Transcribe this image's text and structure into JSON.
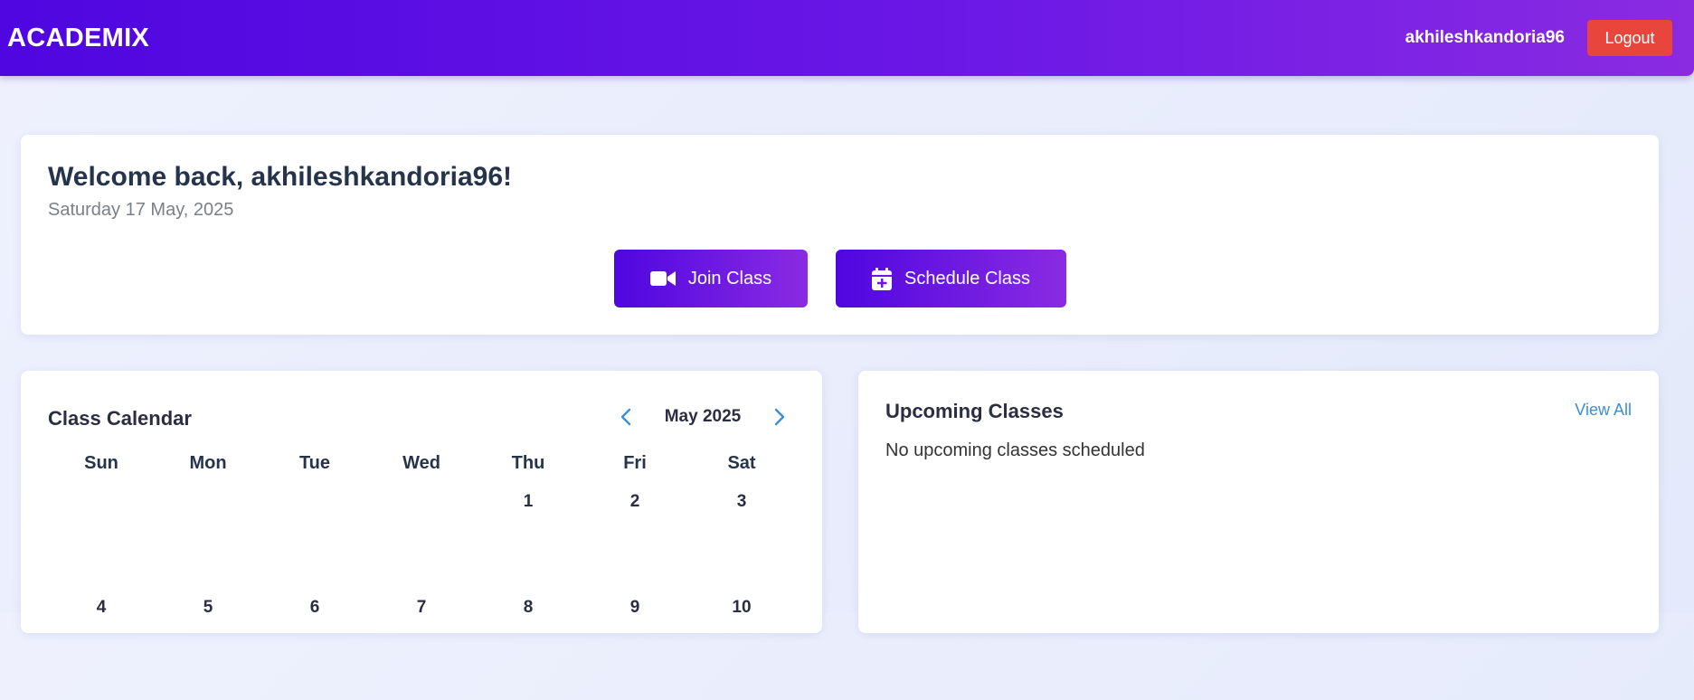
{
  "app": {
    "brand": "ACADEMIX"
  },
  "header": {
    "username": "akhileshkandoria96",
    "logout_label": "Logout"
  },
  "welcome": {
    "title": "Welcome back, akhileshkandoria96!",
    "date": "Saturday 17 May, 2025",
    "join_label": "Join Class",
    "join_icon": "video-camera-icon",
    "schedule_label": "Schedule Class",
    "schedule_icon": "calendar-plus-icon"
  },
  "calendar": {
    "title": "Class Calendar",
    "month_label": "May 2025",
    "prev_icon": "chevron-left-icon",
    "next_icon": "chevron-right-icon",
    "weekdays": [
      "Sun",
      "Mon",
      "Tue",
      "Wed",
      "Thu",
      "Fri",
      "Sat"
    ],
    "weeks": [
      [
        "",
        "",
        "",
        "",
        "1",
        "2",
        "3"
      ],
      [
        "4",
        "5",
        "6",
        "7",
        "8",
        "9",
        "10"
      ]
    ]
  },
  "upcoming": {
    "title": "Upcoming Classes",
    "view_all_label": "View All",
    "empty_message": "No upcoming classes scheduled"
  },
  "colors": {
    "brand_gradient_start": "#4f06e0",
    "brand_gradient_end": "#8a2be2",
    "logout": "#e8453c",
    "link": "#3b8fd6",
    "page_bg": "#e8ecfc"
  }
}
